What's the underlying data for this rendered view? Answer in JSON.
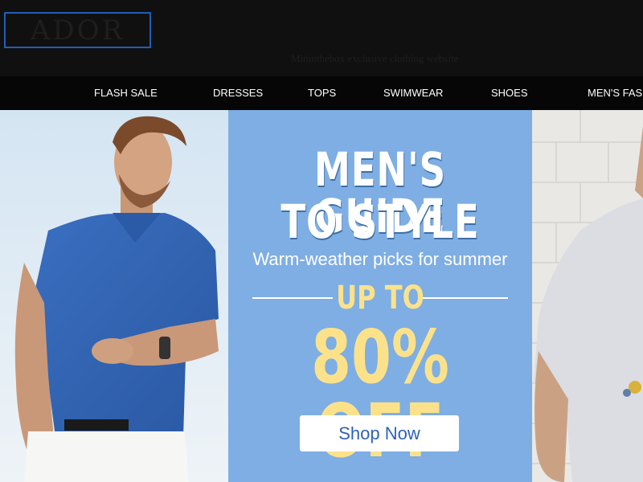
{
  "header": {
    "logo_text": "ADOR",
    "tagline": "Mininthebox exclusive clothing website"
  },
  "nav": {
    "items": [
      {
        "label": "FLASH SALE"
      },
      {
        "label": "DRESSES"
      },
      {
        "label": "TOPS"
      },
      {
        "label": "SWIMWEAR"
      },
      {
        "label": "SHOES"
      },
      {
        "label": "MEN'S FASHION"
      }
    ]
  },
  "hero": {
    "title_line1": "MEN'S GUIDE",
    "title_line2": "TO STYLE",
    "subtitle": "Warm-weather picks for summer",
    "upto": "UP TO",
    "discount": "80% OFF",
    "cta_label": "Shop Now"
  },
  "colors": {
    "promo_bg": "#7eaee3",
    "accent_yellow": "#fbe28a",
    "button_text": "#2f62b5",
    "logo_border": "#1f5fb7",
    "header_bg": "#101010"
  }
}
